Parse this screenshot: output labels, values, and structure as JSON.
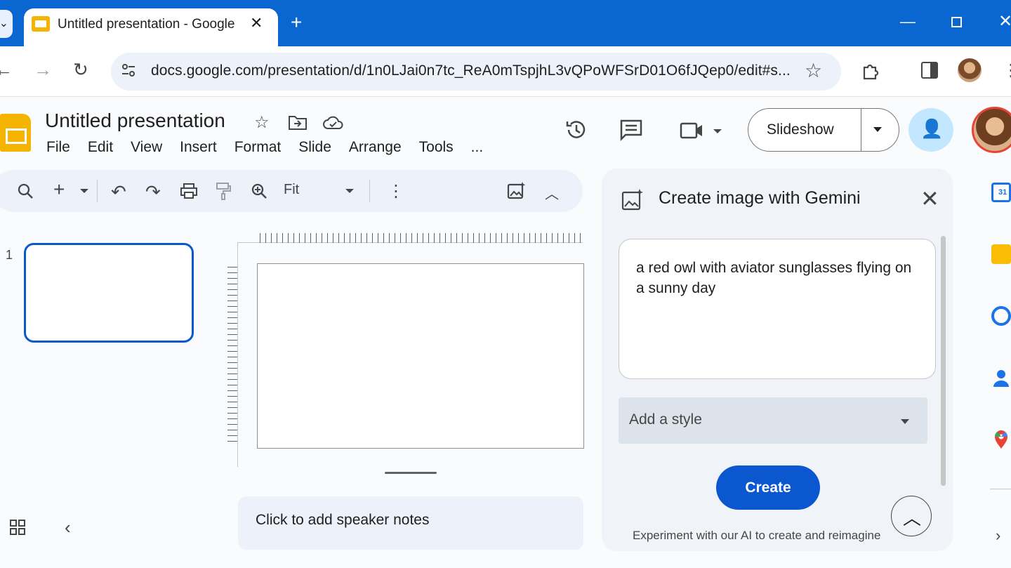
{
  "browser": {
    "tab_title": "Untitled presentation - Google Slides",
    "tab_close": "✕",
    "new_tab": "+",
    "url": "docs.google.com/presentation/d/1n0LJai0n7tc_ReA0mTspjhL3vQPoWFSrD01O6fJQep0/edit#s...",
    "window": {
      "minimize": "—",
      "close": "✕"
    }
  },
  "doc": {
    "title": "Untitled presentation",
    "menu": [
      "File",
      "Edit",
      "View",
      "Insert",
      "Format",
      "Slide",
      "Arrange",
      "Tools",
      "..."
    ],
    "slideshow_label": "Slideshow"
  },
  "toolbar": {
    "zoom_label": "Fit"
  },
  "filmstrip": {
    "slide_number": "1"
  },
  "notes": {
    "placeholder": "Click to add speaker notes"
  },
  "gemini_panel": {
    "title": "Create image with Gemini",
    "prompt": "a red owl with aviator sunglasses flying on a sunny day",
    "style_placeholder": "Add a style",
    "create_label": "Create",
    "disclaimer": "Experiment with our AI to create and reimagine"
  },
  "side_panel": {
    "calendar_day": "31"
  },
  "colors": {
    "chrome_blue": "#0a66d0",
    "primary": "#0b57d0",
    "slides_yellow": "#f4b400",
    "share_bg": "#c2e7ff"
  }
}
